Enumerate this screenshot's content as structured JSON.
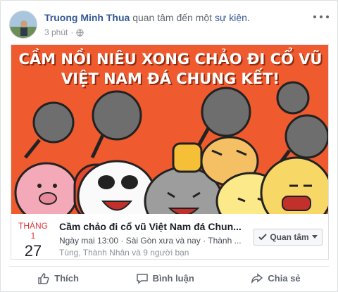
{
  "post": {
    "author": "Truong Minh Thua",
    "action": "quan tâm đến một",
    "object": "sự kiện.",
    "time": "3 phút",
    "privacy_icon": "globe-icon",
    "more_icon": "more-dots-icon"
  },
  "event": {
    "banner_line1": "CẦM NỒI NIÊU XONG CHẢO ĐI CỔ VŨ",
    "banner_line2": "VIỆT NAM ĐÁ CHUNG KẾT!",
    "month": "THÁNG 1",
    "day": "27",
    "title": "Cầm chảo đi cổ vũ Việt Nam đá Chun...",
    "when": "Ngày mai 13:00 · Sài Gòn xưa và nay · Thành ...",
    "friends": "Tùng, Thành Nhân và 9 người bạn",
    "interest_label": "Quan tâm",
    "accent_color": "#e0393e",
    "banner_color": "#ef5a2e"
  },
  "footer": {
    "like": "Thích",
    "comment": "Bình luận",
    "share": "Chia sẻ"
  }
}
